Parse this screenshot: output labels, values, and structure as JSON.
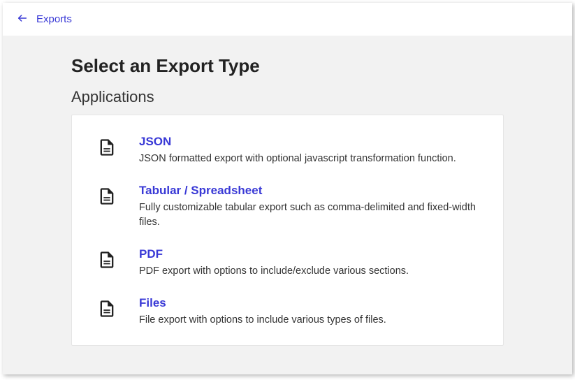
{
  "header": {
    "breadcrumb": "Exports"
  },
  "page": {
    "title": "Select an Export Type",
    "section": "Applications"
  },
  "exports": [
    {
      "name": "json",
      "title": "JSON",
      "desc": "JSON formatted export with optional javascript transformation function."
    },
    {
      "name": "tabular",
      "title": "Tabular / Spreadsheet",
      "desc": "Fully customizable tabular export such as comma-delimited and fixed-width files."
    },
    {
      "name": "pdf",
      "title": "PDF",
      "desc": "PDF export with options to include/exclude various sections."
    },
    {
      "name": "files",
      "title": "Files",
      "desc": "File export with options to include various types of files."
    }
  ]
}
